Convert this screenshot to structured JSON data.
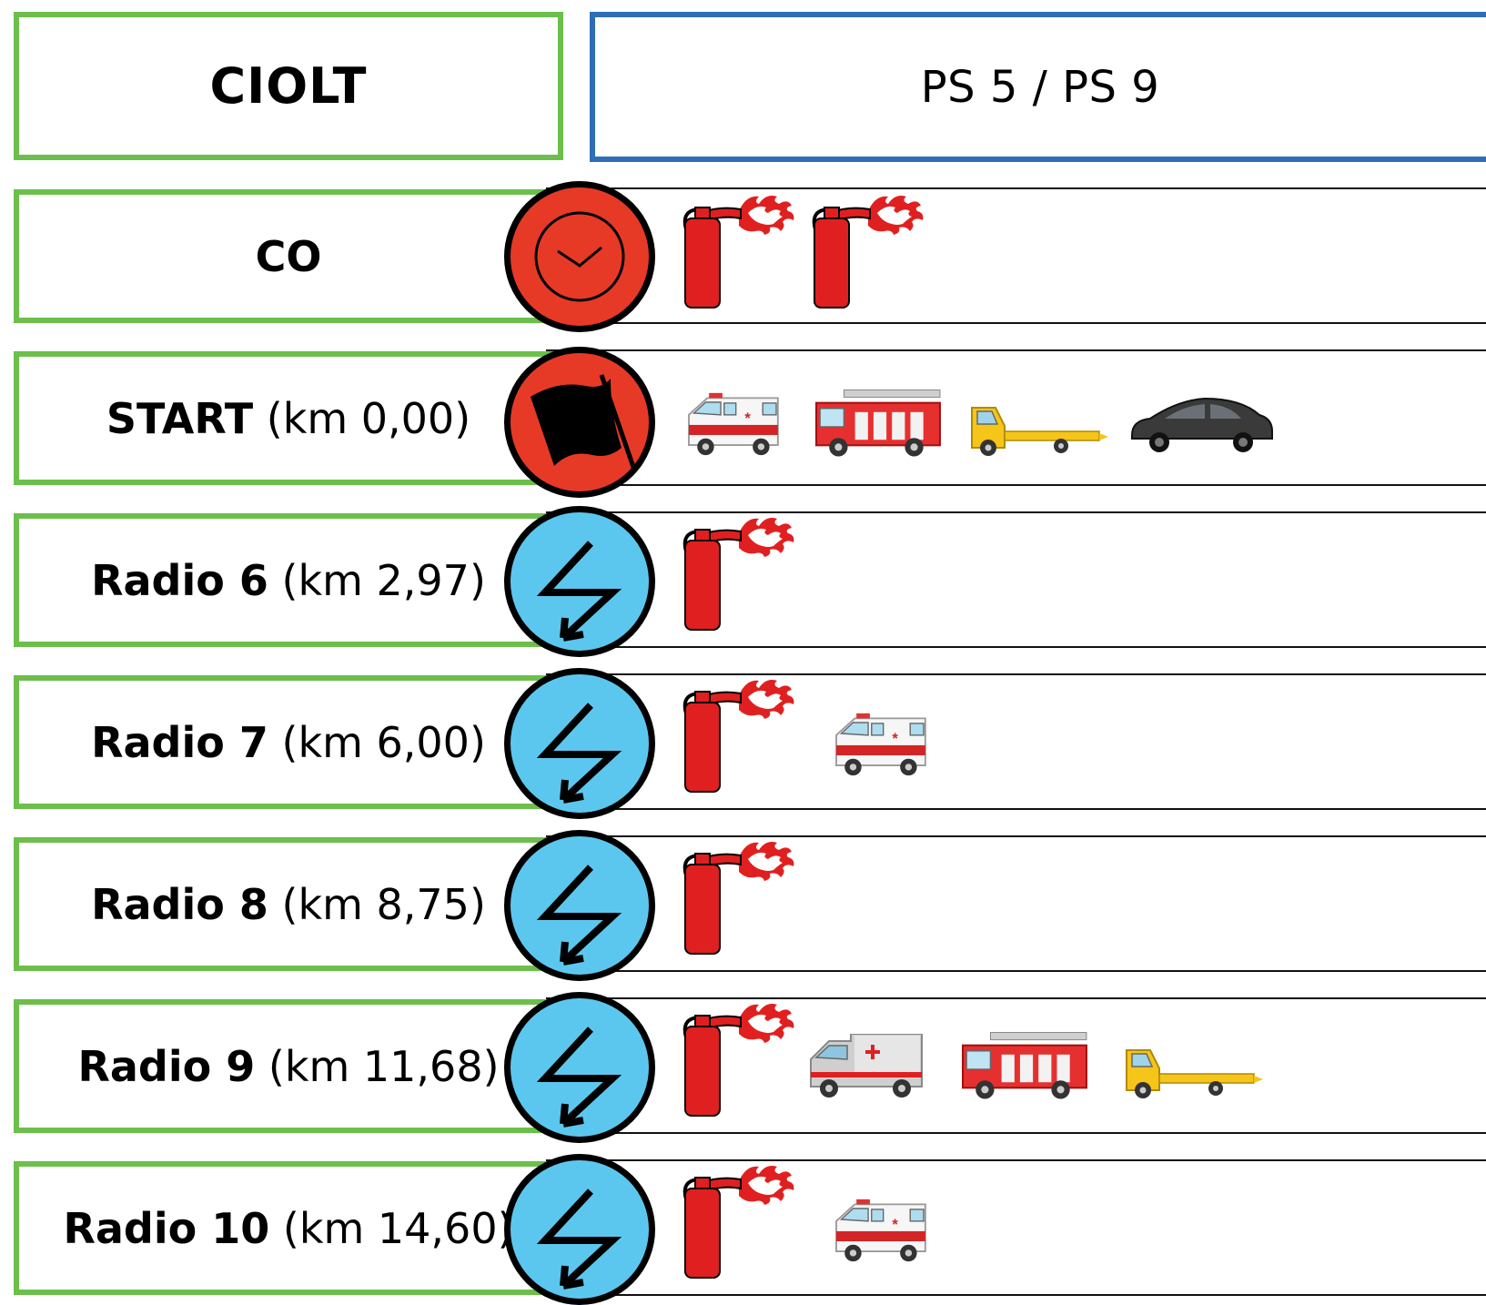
{
  "header": {
    "left_title": "CIOLT",
    "right_title": "PS 5 / PS 9"
  },
  "rows": [
    {
      "name": "CO",
      "km": "",
      "marker": "clock-icon",
      "vehicles": [
        "fire-extinguisher",
        "fire-extinguisher"
      ]
    },
    {
      "name": "START",
      "km": "(km 0,00)",
      "marker": "flag-icon",
      "vehicles": [
        "ambulance",
        "fire-truck",
        "tow-truck",
        "car"
      ]
    },
    {
      "name": "Radio 6",
      "km": "(km 2,97)",
      "marker": "radio-lightning-icon",
      "vehicles": [
        "fire-extinguisher"
      ]
    },
    {
      "name": "Radio 7",
      "km": "(km 6,00)",
      "marker": "radio-lightning-icon",
      "vehicles": [
        "fire-extinguisher",
        "ambulance"
      ]
    },
    {
      "name": "Radio 8",
      "km": "(km 8,75)",
      "marker": "radio-lightning-icon",
      "vehicles": [
        "fire-extinguisher"
      ]
    },
    {
      "name": "Radio 9",
      "km": "(km 11,68)",
      "marker": "radio-lightning-icon",
      "vehicles": [
        "fire-extinguisher",
        "ambulance-grey",
        "fire-truck",
        "tow-truck"
      ]
    },
    {
      "name": "Radio 10",
      "km": "(km 14,60)",
      "marker": "radio-lightning-icon",
      "vehicles": [
        "fire-extinguisher",
        "ambulance"
      ]
    }
  ],
  "colors": {
    "left_border": "#6cbf4a",
    "header_right_border": "#2f6eb5",
    "marker_red": "#e63a27",
    "marker_blue": "#5cc7ee",
    "extinguisher_red": "#e02020"
  }
}
